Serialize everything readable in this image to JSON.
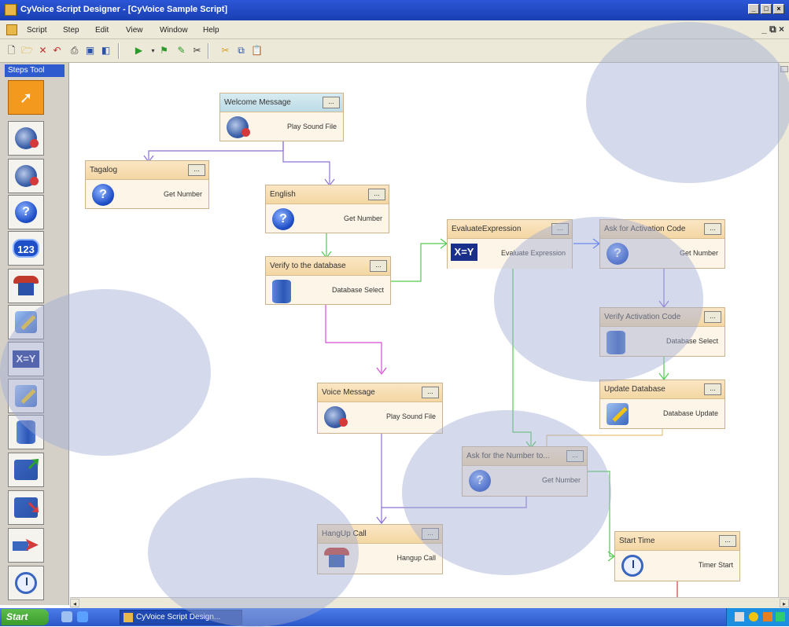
{
  "window": {
    "title": "CyVoice Script Designer - [CyVoice Sample Script]"
  },
  "menu": {
    "items": [
      "Script",
      "Step",
      "Edit",
      "View",
      "Window",
      "Help"
    ],
    "mdi_controls": "_ ⧉ ×"
  },
  "toolbar": {
    "buttons": [
      "new-icon",
      "open-icon",
      "delete-icon",
      "undo-icon",
      "print-icon",
      "save-icon",
      "save-as-icon",
      "run-icon",
      "debug-icon",
      "properties-icon",
      "cut-icon",
      "copy-icon",
      "paste-icon"
    ]
  },
  "steps_tool": {
    "header": "Steps Tool",
    "tools": [
      "pointer",
      "play-sound-file",
      "record-sound",
      "get-number",
      "get-digits",
      "transfer-call",
      "send-fax",
      "evaluate-expression",
      "database-update",
      "database-select",
      "database-insert",
      "database-delete",
      "goto-step",
      "timer-start"
    ]
  },
  "nodes": [
    {
      "id": "welcome",
      "title": "Welcome Message",
      "type": "Play Sound File",
      "icon": "speaker-icon"
    },
    {
      "id": "tagalog",
      "title": "Tagalog",
      "type": "Get Number",
      "icon": "question-icon"
    },
    {
      "id": "english",
      "title": "English",
      "type": "Get Number",
      "icon": "question-icon"
    },
    {
      "id": "verify_db",
      "title": "Verify to the database",
      "type": "Database Select",
      "icon": "database-icon"
    },
    {
      "id": "evaluate",
      "title": "EvaluateExpression",
      "type": "Evaluate Expression",
      "icon": "xy-icon",
      "icon_text": "X=Y"
    },
    {
      "id": "ask_activation",
      "title": "Ask for Activation Code",
      "type": "Get Number",
      "icon": "question-icon"
    },
    {
      "id": "verify_activation",
      "title": "Verify Activation Code",
      "type": "Database Select",
      "icon": "database-icon"
    },
    {
      "id": "update_db",
      "title": "Update Database",
      "type": "Database Update",
      "icon": "pencil-icon"
    },
    {
      "id": "voice_message",
      "title": "Voice Message",
      "type": "Play Sound File",
      "icon": "speaker-icon"
    },
    {
      "id": "ask_number",
      "title": "Ask for the Number to...",
      "type": "Get Number",
      "icon": "question-icon"
    },
    {
      "id": "hangup",
      "title": "HangUp Call",
      "type": "Hangup Call",
      "icon": "phone-icon"
    },
    {
      "id": "start_time",
      "title": "Start Time",
      "type": "Timer Start",
      "icon": "clock-icon"
    }
  ],
  "node_more_label": "...",
  "taskbar": {
    "start_label": "Start",
    "task_label": "CyVoice Script Design..."
  },
  "colors": {
    "connector_purple": "#8c6fd8",
    "connector_magenta": "#d84bd8",
    "connector_green": "#4fcc4f",
    "connector_blue": "#3f6cff",
    "connector_red": "#d43a3a",
    "connector_orange": "#e6c27a",
    "node_header": "#f3d6a3",
    "node_selected_header": "#bcdbe6",
    "active_tool": "#f39a1e"
  }
}
